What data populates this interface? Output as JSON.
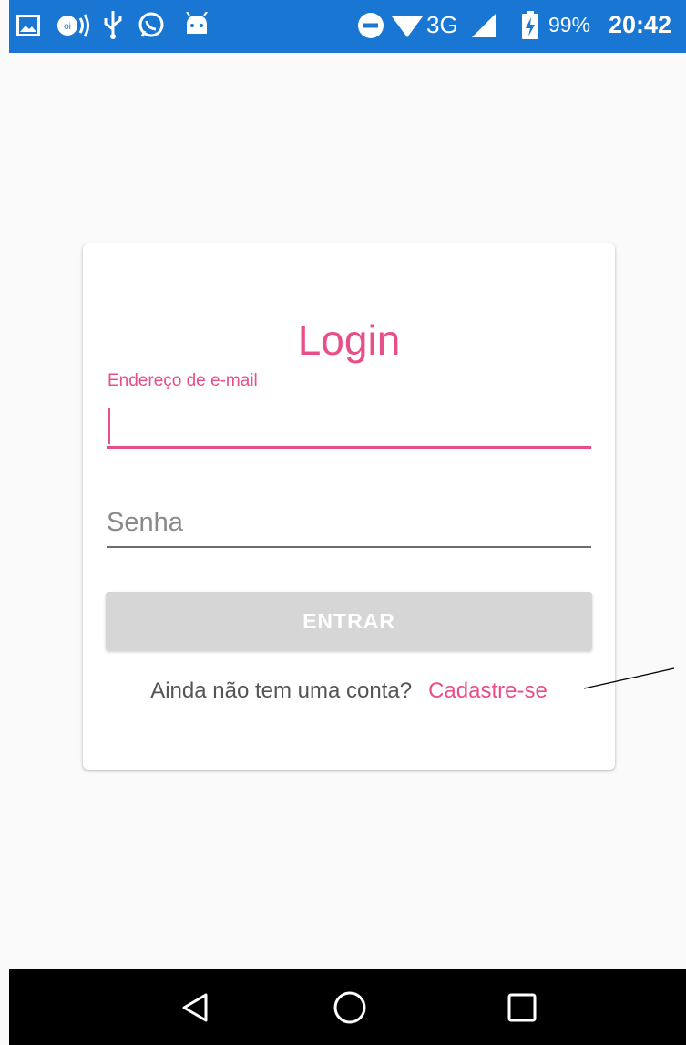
{
  "status_bar": {
    "network": "3G",
    "battery_percent": "99%",
    "time": "20:42",
    "icons": [
      "gallery-icon",
      "radio-icon",
      "usb-icon",
      "whatsapp-icon",
      "android-icon",
      "do-not-disturb-icon",
      "wifi-icon",
      "signal-icon",
      "battery-charging-icon"
    ]
  },
  "login": {
    "title": "Login",
    "email_label": "Endereço de e-mail",
    "email_value": "",
    "password_placeholder": "Senha",
    "enter_label": "ENTRAR",
    "signup_question": "Ainda não tem uma conta?",
    "signup_link": "Cadastre-se"
  },
  "nav_bar": {
    "icons": [
      "back-icon",
      "home-icon",
      "recents-icon"
    ]
  },
  "colors": {
    "accent": "#e84e89",
    "status_bar": "#1976d2",
    "button_disabled": "#d6d6d6",
    "background": "#fafafa"
  }
}
